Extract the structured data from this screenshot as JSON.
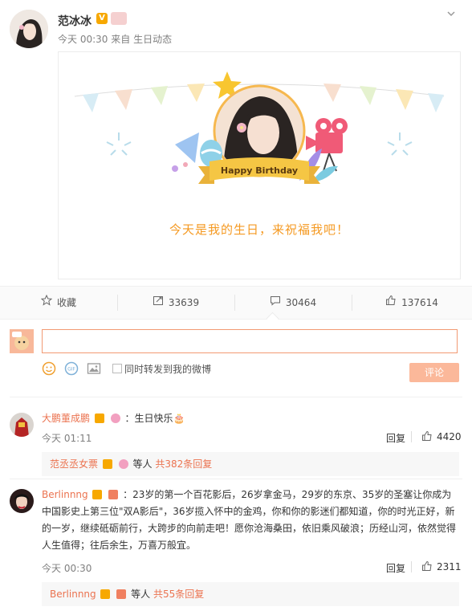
{
  "post": {
    "author_name": "范冰冰",
    "verified_badge": "V",
    "time": "今天 00:30",
    "source_prefix": "来自",
    "source": "生日动态",
    "card_text": "今天是我的生日，来祝福我吧！",
    "card_ribbon": "Happy Birthday"
  },
  "actions": {
    "favorite_label": "收藏",
    "repost_count": "33639",
    "comment_count": "30464",
    "like_count": "137614"
  },
  "composer": {
    "placeholder": "",
    "repost_label": "同时转发到我的微博",
    "submit_label": "评论"
  },
  "comments": [
    {
      "user": "大鹏董成鹏",
      "text": "：生日快乐🎂",
      "time": "今天 01:11",
      "reply_label": "回复",
      "likes": "4420",
      "sub_user": "范丞丞女票",
      "sub_tail": "等人",
      "sub_count": "共382条回复"
    },
    {
      "user": "Berlinnng",
      "text": "：23岁的第一个百花影后，26岁拿金马，29岁的东京、35岁的圣塞让你成为中国影史上第三位\"双A影后\"，36岁揽入怀中的金鸡，你和你的影迷们都知道，你的时光正好，新的一岁，继续砥砺前行，大跨步的向前走吧！愿你沧海桑田，依旧乘风破浪；历经山河，依然觉得人生值得；往后余生，万喜万般宜。",
      "time": "今天 00:30",
      "reply_label": "回复",
      "likes": "2311",
      "sub_user": "Berlinnng",
      "sub_tail": "等人",
      "sub_count": "共55条回复"
    }
  ],
  "colors": {
    "accent": "#eb7350",
    "gold": "#f59a23",
    "submit_bg": "#fbb89a"
  }
}
